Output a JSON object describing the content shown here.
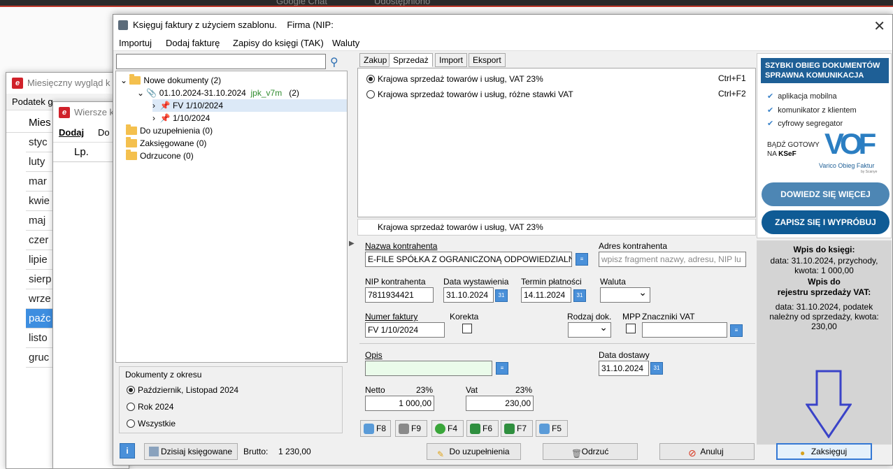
{
  "background": {
    "browser_tabs": [
      "Google Chat",
      "Udostępniono"
    ]
  },
  "back_window_1": {
    "title": "Miesięczny wygląd k",
    "menu": "Podatek g",
    "column_header": "Mies",
    "months": [
      "styc",
      "luty",
      "mar",
      "kwie",
      "maj",
      "czer",
      "lipie",
      "sierp",
      "wrze",
      "paźc",
      "listo",
      "gruc"
    ],
    "selected_index": 9
  },
  "back_window_2": {
    "title": "Wiersze k",
    "menu_add": "Dodaj",
    "menu_other": "Do",
    "column_header": "Lp."
  },
  "main_window": {
    "title": "Księguj faktury z użyciem szablonu.",
    "firm": "Firma (NIP:",
    "menu": [
      "Importuj",
      "Dodaj fakturę",
      "Zapisy do księgi (TAK)",
      "Waluty"
    ],
    "search": {
      "value": "",
      "placeholder": ""
    },
    "tree": {
      "new_docs": "Nowe dokumenty (2)",
      "period": "01.10.2024-31.10.2024",
      "period_tag": "jpk_v7m",
      "period_count": "(2)",
      "doc1": "FV 1/10/2024",
      "doc2": "1/10/2024",
      "to_complete": "Do uzupełnienia (0)",
      "booked": "Zaksięgowane (0)",
      "rejected": "Odrzucone (0)"
    },
    "period_box": {
      "legend": "Dokumenty z okresu",
      "options": [
        "Październik, Listopad 2024",
        "Rok 2024",
        "Wszystkie"
      ],
      "selected": 0
    },
    "tabs": [
      "Zakup",
      "Sprzedaż",
      "Import",
      "Eksport"
    ],
    "active_tab": 1,
    "templates": [
      {
        "label": "Krajowa sprzedaż towarów i usług, VAT 23%",
        "shortcut": "Ctrl+F1",
        "selected": true
      },
      {
        "label": "Krajowa sprzedaż towarów i usług, różne stawki VAT",
        "shortcut": "Ctrl+F2",
        "selected": false
      }
    ],
    "selected_template_caption": "Krajowa sprzedaż towarów i usług, VAT 23%",
    "form": {
      "contractor_label": "Nazwa kontrahenta",
      "contractor_value": "E-FILE SPÓŁKA Z OGRANICZONĄ ODPOWIEDZIALNOŚ",
      "address_label": "Adres kontrahenta",
      "address_placeholder": "wpisz fragment nazwy, adresu, NIP lu",
      "nip_label": "NIP kontrahenta",
      "nip_value": "7811934421",
      "issue_date_label": "Data wystawienia",
      "issue_date_value": "31.10.2024",
      "due_date_label": "Termin płatności",
      "due_date_value": "14.11.2024",
      "currency_label": "Waluta",
      "currency_value": "",
      "invoice_no_label": "Numer faktury",
      "invoice_no_value": "FV 1/10/2024",
      "correction_label": "Korekta",
      "doc_type_label": "Rodzaj dok.",
      "mpp_label": "MPP",
      "vat_flags_label": "Znaczniki VAT",
      "desc_label": "Opis",
      "desc_value": "",
      "delivery_date_label": "Data dostawy",
      "delivery_date_value": "31.10.2024",
      "net_label": "Netto",
      "net_rate": "23%",
      "net_value": "1 000,00",
      "vat_label": "Vat",
      "vat_rate": "23%",
      "vat_value": "230,00"
    },
    "fkeys": [
      "F8",
      "F9",
      "F4",
      "F6",
      "F7",
      "F5"
    ],
    "bottom": {
      "today_booked": "Dzisiaj księgowane",
      "gross_label": "Brutto:",
      "gross_value": "1 230,00",
      "to_complete_btn": "Do uzupełnienia",
      "reject_btn": "Odrzuć",
      "cancel_btn": "Anuluj",
      "book_btn": "Zaksięguj"
    },
    "ad": {
      "headline1": "SZYBKI OBIEG DOKUMENTÓW",
      "headline2": "SPRAWNA KOMUNIKACJA",
      "items": [
        "aplikacja mobilna",
        "komunikator z klientem",
        "cyfrowy segregator"
      ],
      "ready1": "BĄDŹ GOTOWY",
      "ready2": "NA",
      "ready3": "KSeF",
      "logo_text": "VOF",
      "brand": "Varico Obieg Faktur",
      "brand_by": "by Scanye",
      "learn_more": "DOWIEDZ SIĘ WIĘCEJ",
      "signup": "ZAPISZ SIĘ I WYPRÓBUJ",
      "colors": {
        "navy": "#1e5f96",
        "pill1": "#4d86b4",
        "pill2": "#0f5b95"
      }
    },
    "entry_info": {
      "ledger_title": "Wpis do księgi:",
      "ledger_text": "data: 31.10.2024, przychody, kwota: 1 000,00",
      "vat_title1": "Wpis do",
      "vat_title2": "rejestru sprzedaży VAT:",
      "vat_text": "data: 31.10.2024, podatek należny od sprzedaży, kwota: 230,00"
    }
  }
}
